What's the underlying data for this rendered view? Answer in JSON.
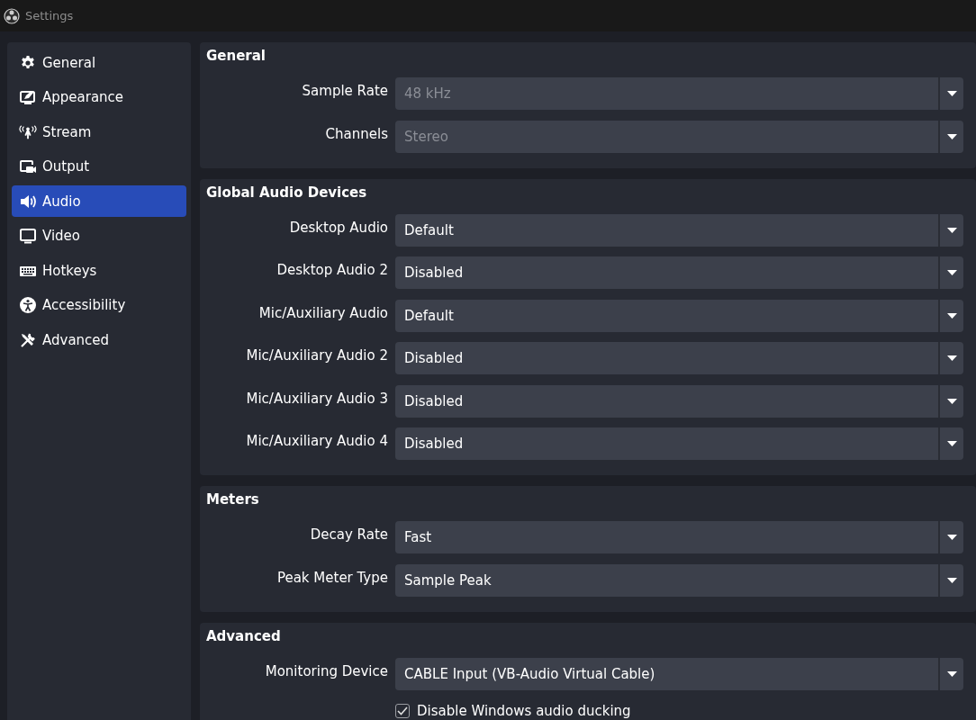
{
  "window": {
    "title": "Settings"
  },
  "sidebar": {
    "items": [
      {
        "label": "General",
        "selected": false
      },
      {
        "label": "Appearance",
        "selected": false
      },
      {
        "label": "Stream",
        "selected": false
      },
      {
        "label": "Output",
        "selected": false
      },
      {
        "label": "Audio",
        "selected": true
      },
      {
        "label": "Video",
        "selected": false
      },
      {
        "label": "Hotkeys",
        "selected": false
      },
      {
        "label": "Accessibility",
        "selected": false
      },
      {
        "label": "Advanced",
        "selected": false
      }
    ]
  },
  "groups": [
    {
      "title": "General",
      "rows": [
        {
          "kind": "combo",
          "label": "Sample Rate",
          "value": "48 kHz",
          "disabled": true
        },
        {
          "kind": "combo",
          "label": "Channels",
          "value": "Stereo",
          "disabled": true
        }
      ]
    },
    {
      "title": "Global Audio Devices",
      "rows": [
        {
          "kind": "combo",
          "label": "Desktop Audio",
          "value": "Default",
          "disabled": false
        },
        {
          "kind": "combo",
          "label": "Desktop Audio 2",
          "value": "Disabled",
          "disabled": false
        },
        {
          "kind": "combo",
          "label": "Mic/Auxiliary Audio",
          "value": "Default",
          "disabled": false
        },
        {
          "kind": "combo",
          "label": "Mic/Auxiliary Audio 2",
          "value": "Disabled",
          "disabled": false
        },
        {
          "kind": "combo",
          "label": "Mic/Auxiliary Audio 3",
          "value": "Disabled",
          "disabled": false
        },
        {
          "kind": "combo",
          "label": "Mic/Auxiliary Audio 4",
          "value": "Disabled",
          "disabled": false
        }
      ]
    },
    {
      "title": "Meters",
      "rows": [
        {
          "kind": "combo",
          "label": "Decay Rate",
          "value": "Fast",
          "disabled": false
        },
        {
          "kind": "combo",
          "label": "Peak Meter Type",
          "value": "Sample Peak",
          "disabled": false
        }
      ]
    },
    {
      "title": "Advanced",
      "rows": [
        {
          "kind": "combo",
          "label": "Monitoring Device",
          "value": "CABLE Input (VB-Audio Virtual Cable)",
          "disabled": false
        },
        {
          "kind": "checkbox",
          "label": "Disable Windows audio ducking",
          "checked": true
        }
      ]
    }
  ]
}
